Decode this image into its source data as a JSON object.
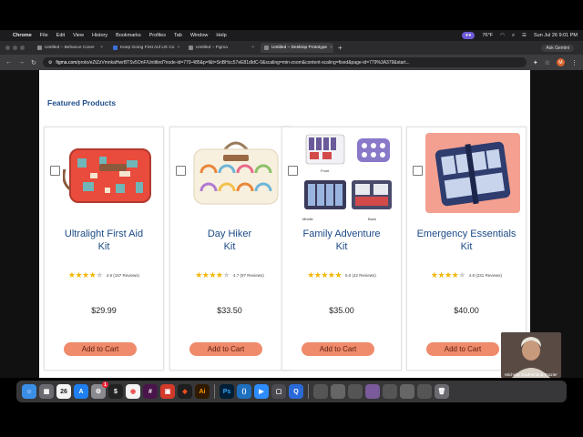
{
  "menubar": {
    "app": "Chrome",
    "items": [
      "File",
      "Edit",
      "View",
      "History",
      "Bookmarks",
      "Profiles",
      "Tab",
      "Window",
      "Help"
    ],
    "weather": "76°F",
    "datetime": "Sun Jul 26  9:01 PM"
  },
  "tabs": [
    {
      "title": "Untitled – Behance Cover",
      "active": false
    },
    {
      "title": "Keep Going First Aid UX Co",
      "active": false
    },
    {
      "title": "Untitled – Figma",
      "active": false
    },
    {
      "title": "Untitled – Desktop Prototype",
      "active": true
    }
  ],
  "ask_gemini": "Ask Gemini",
  "address": {
    "domain": "figma.com",
    "path": "/proto/eZtZzVmnkaHwrBTSv5OnF/Untitled?node-id=779-485&p=f&t=SnBHcc57eE81dIdC-0&scaling=min-zoom&content-scaling=fixed&page-id=779%3A379&start..."
  },
  "profile_initial": "M",
  "section_title": "Featured Products",
  "products": [
    {
      "name_line1": "Ultralight First Aid",
      "name_line2": "Kit",
      "stars": 4,
      "rating_text": "4.9 (187 Reviews)",
      "price": "$29.99",
      "button": "Add to Cart"
    },
    {
      "name_line1": "Day Hiker",
      "name_line2": "Kit",
      "stars": 4,
      "rating_text": "4.7 (97 Reviews)",
      "price": "$33.50",
      "button": "Add to Cart"
    },
    {
      "name_line1": "Family Adventure",
      "name_line2": "Kit",
      "stars": 5,
      "rating_text": "5.0 (42 Reviews)",
      "price": "$35.00",
      "button": "Add to Cart"
    },
    {
      "name_line1": "Emergency Essentials",
      "name_line2": "Kit",
      "stars": 4,
      "rating_text": "4.8 (231 Reviews)",
      "price": "$40.00",
      "button": "Add to Cart"
    }
  ],
  "family_image_labels": {
    "front": "Front",
    "middle": "Middle",
    "back": "Back"
  },
  "dock": {
    "calendar_day": "26",
    "badge_count": "1",
    "apps": [
      "finder",
      "launchpad",
      "calendar",
      "app-store",
      "settings",
      "terminal",
      "chrome",
      "slack",
      "photoshop-red",
      "figma",
      "illustrator",
      "photoshop",
      "vscode",
      "zoom",
      "webex",
      "quicktime"
    ]
  },
  "video_name": "Michelle Southerland-Frazier",
  "colors": {
    "accent_blue": "#1b4a86",
    "button": "#ef8a6b",
    "star": "#f2b705"
  }
}
